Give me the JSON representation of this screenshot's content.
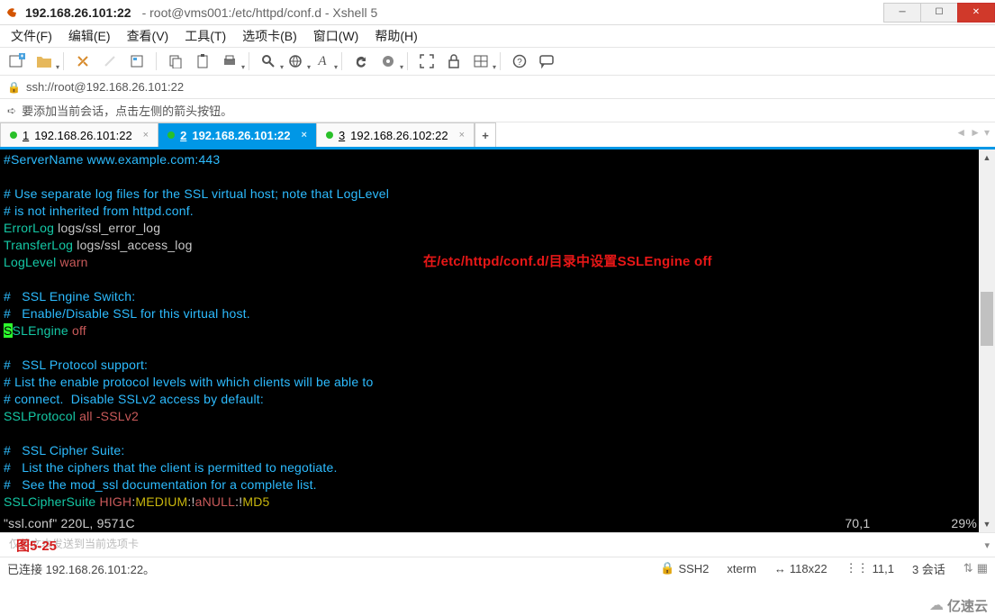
{
  "title_bar": {
    "ip": "192.168.26.101:22",
    "path": "root@vms001:/etc/httpd/conf.d - Xshell 5"
  },
  "menu": [
    "文件(F)",
    "编辑(E)",
    "查看(V)",
    "工具(T)",
    "选项卡(B)",
    "窗口(W)",
    "帮助(H)"
  ],
  "url_row": {
    "url": "ssh://root@192.168.26.101:22"
  },
  "hint_row": {
    "text": "要添加当前会话，点击左侧的箭头按钮。"
  },
  "tabs": [
    {
      "num": "1",
      "label": "192.168.26.101:22",
      "active": false
    },
    {
      "num": "2",
      "label": "192.168.26.101:22",
      "active": true
    },
    {
      "num": "3",
      "label": "192.168.26.102:22",
      "active": false
    }
  ],
  "terminal": {
    "annotation": "在/etc/httpd/conf.d/目录中设置SSLEngine off",
    "lines": [
      {
        "cls": "c-comment",
        "t": "#ServerName www.example.com:443"
      },
      {
        "cls": "",
        "t": " "
      },
      {
        "cls": "c-comment",
        "t": "# Use separate log files for the SSL virtual host; note that LogLevel"
      },
      {
        "cls": "c-comment",
        "t": "# is not inherited from httpd.conf."
      },
      {
        "seg": [
          {
            "cls": "c-key",
            "t": "ErrorLog"
          },
          {
            "cls": "c-str",
            "t": " logs/ssl_error_log"
          }
        ]
      },
      {
        "seg": [
          {
            "cls": "c-key",
            "t": "TransferLog"
          },
          {
            "cls": "c-str",
            "t": " logs/ssl_access_log"
          }
        ]
      },
      {
        "seg": [
          {
            "cls": "c-key",
            "t": "LogLevel"
          },
          {
            "cls": "c-val",
            "t": " warn"
          }
        ]
      },
      {
        "cls": "",
        "t": " "
      },
      {
        "cls": "c-comment",
        "t": "#   SSL Engine Switch:"
      },
      {
        "cls": "c-comment",
        "t": "#   Enable/Disable SSL for this virtual host."
      },
      {
        "seg": [
          {
            "cls": "cursor",
            "t": "S"
          },
          {
            "cls": "c-key",
            "t": "SLEngine"
          },
          {
            "cls": "c-val",
            "t": " off"
          }
        ]
      },
      {
        "cls": "",
        "t": " "
      },
      {
        "cls": "c-comment",
        "t": "#   SSL Protocol support:"
      },
      {
        "cls": "c-comment",
        "t": "# List the enable protocol levels with which clients will be able to"
      },
      {
        "cls": "c-comment",
        "t": "# connect.  Disable SSLv2 access by default:"
      },
      {
        "seg": [
          {
            "cls": "c-key",
            "t": "SSLProtocol"
          },
          {
            "cls": "c-val",
            "t": " all -SSLv2"
          }
        ]
      },
      {
        "cls": "",
        "t": " "
      },
      {
        "cls": "c-comment",
        "t": "#   SSL Cipher Suite:"
      },
      {
        "cls": "c-comment",
        "t": "#   List the ciphers that the client is permitted to negotiate."
      },
      {
        "cls": "c-comment",
        "t": "#   See the mod_ssl documentation for a complete list."
      },
      {
        "seg": [
          {
            "cls": "c-key",
            "t": "SSLCipherSuite"
          },
          {
            "cls": "c-val",
            "t": " HIGH"
          },
          {
            "cls": "c-str",
            "t": ":"
          },
          {
            "cls": "c-yel",
            "t": "MEDIUM"
          },
          {
            "cls": "c-str",
            "t": ":!"
          },
          {
            "cls": "c-val",
            "t": "aNULL"
          },
          {
            "cls": "c-str",
            "t": ":!"
          },
          {
            "cls": "c-yel",
            "t": "MD5"
          }
        ]
      }
    ],
    "vim_status": {
      "file": "\"ssl.conf\" 220L, 9571C",
      "pos": "70,1",
      "pct": "29%"
    }
  },
  "bottom": {
    "placeholder": "仅将文本发送到当前选项卡",
    "send_label": "发送到当前选项卡",
    "caption": "图5-25"
  },
  "status": {
    "conn": "已连接 192.168.26.101:22。",
    "proto": "SSH2",
    "term": "xterm",
    "size": "118x22",
    "cursor": "11,1",
    "sess": "3 会话",
    "logo": "亿速云"
  }
}
